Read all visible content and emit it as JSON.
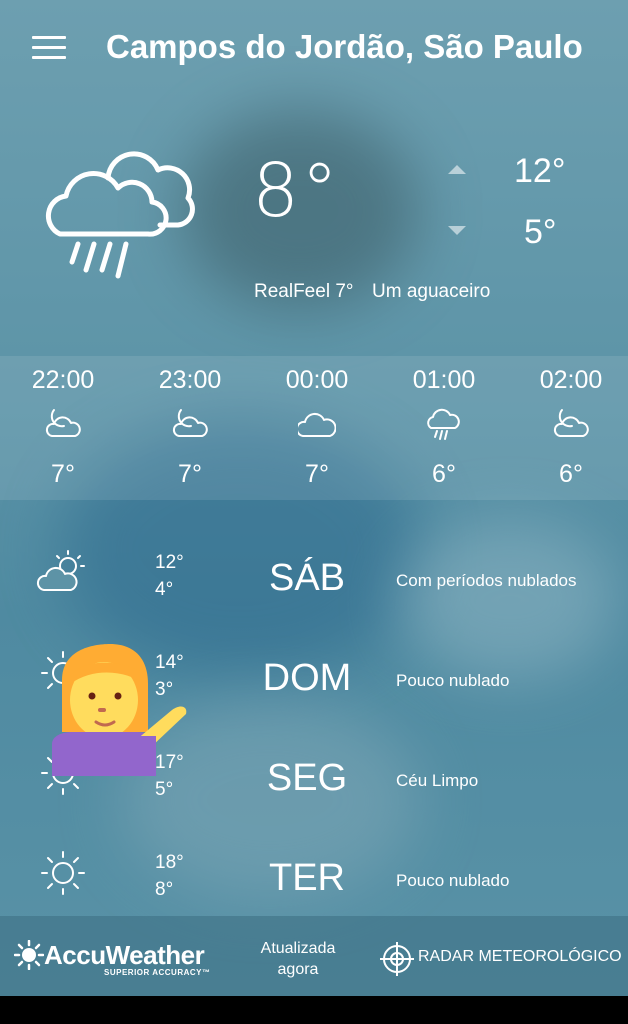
{
  "header": {
    "menu_icon": "hamburger-menu-icon",
    "city": "Campos do Jordão, São Paulo"
  },
  "current": {
    "icon": "rain-cloud-icon",
    "temp": "8°",
    "high": "12°",
    "low": "5°",
    "realfeel": "RealFeel 7°",
    "description": "Um aguaceiro"
  },
  "hourly": [
    {
      "time": "22:00",
      "icon": "moon-cloud-icon",
      "temp": "7°"
    },
    {
      "time": "23:00",
      "icon": "moon-cloud-icon",
      "temp": "7°"
    },
    {
      "time": "00:00",
      "icon": "cloud-icon",
      "temp": "7°"
    },
    {
      "time": "01:00",
      "icon": "rain-cloud-icon",
      "temp": "6°"
    },
    {
      "time": "02:00",
      "icon": "moon-cloud-icon",
      "temp": "6°"
    }
  ],
  "daily": [
    {
      "icon": "sun-cloud-icon",
      "high": "12°",
      "low": "4°",
      "day": "SÁB",
      "description": "Com períodos nublados"
    },
    {
      "icon": "sun-icon",
      "high": "14°",
      "low": "3°",
      "day": "DOM",
      "description": "Pouco nublado"
    },
    {
      "icon": "sun-icon",
      "high": "17°",
      "low": "5°",
      "day": "SEG",
      "description": "Céu Limpo"
    },
    {
      "icon": "sun-icon",
      "high": "18°",
      "low": "8°",
      "day": "TER",
      "description": "Pouco nublado"
    }
  ],
  "overlay": {
    "icon": "person-tipping-hand-emoji"
  },
  "footer": {
    "brand": "AccuWeather",
    "brand_sub": "SUPERIOR ACCURACY™",
    "updated_line1": "Atualizada",
    "updated_line2": "agora",
    "radar_label": "RADAR METEOROLÓGICO"
  }
}
